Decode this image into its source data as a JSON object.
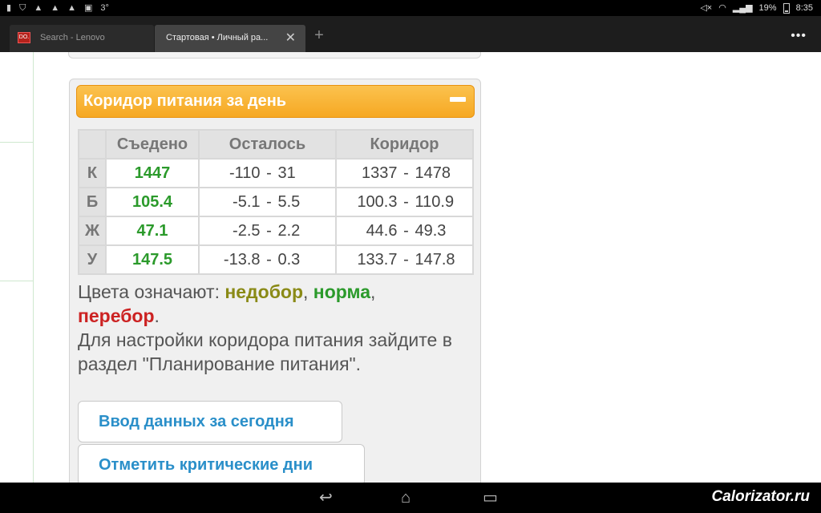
{
  "status_bar": {
    "left_icons": [
      "usb-icon",
      "shield-icon",
      "warning-icon",
      "warning-icon",
      "warning-icon",
      "image-icon"
    ],
    "weather": "3°",
    "battery": "19%",
    "time": "8:35"
  },
  "tabs": [
    {
      "title": "Search - Lenovo",
      "favicon": "DO."
    },
    {
      "title": "Стартовая • Личный ра...",
      "active": true
    }
  ],
  "widget": {
    "title": "Коридор питания за день",
    "columns": [
      "",
      "Съедено",
      "Осталось",
      "Коридор"
    ],
    "rows": [
      {
        "label": "К",
        "eaten": "1447",
        "left_from": "-110",
        "left_to": "31",
        "range_from": "1337",
        "range_to": "1478"
      },
      {
        "label": "Б",
        "eaten": "105.4",
        "left_from": "-5.1",
        "left_to": "5.5",
        "range_from": "100.3",
        "range_to": "110.9"
      },
      {
        "label": "Ж",
        "eaten": "47.1",
        "left_from": "-2.5",
        "left_to": "2.2",
        "range_from": "44.6",
        "range_to": "49.3"
      },
      {
        "label": "У",
        "eaten": "147.5",
        "left_from": "-13.8",
        "left_to": "0.3",
        "range_from": "133.7",
        "range_to": "147.8"
      }
    ],
    "dash": "-",
    "legend": {
      "prefix": "Цвета означают: ",
      "under": "недобор",
      "comma1": ", ",
      "norm": "норма",
      "comma2": ",",
      "over": "перебор",
      "period": "."
    },
    "hint": "Для настройки коридора питания зайдите в раздел \"Планирование питания\".",
    "buttons": {
      "enter_data": "Ввод данных за сегодня",
      "mark_days": "Отметить критические дни"
    }
  },
  "colors": {
    "header": "#f6a823",
    "under": "#8a8a16",
    "norm": "#2b9a2b",
    "over": "#cc2222",
    "link": "#2a8fc9"
  },
  "watermark": "Calorizator.ru"
}
